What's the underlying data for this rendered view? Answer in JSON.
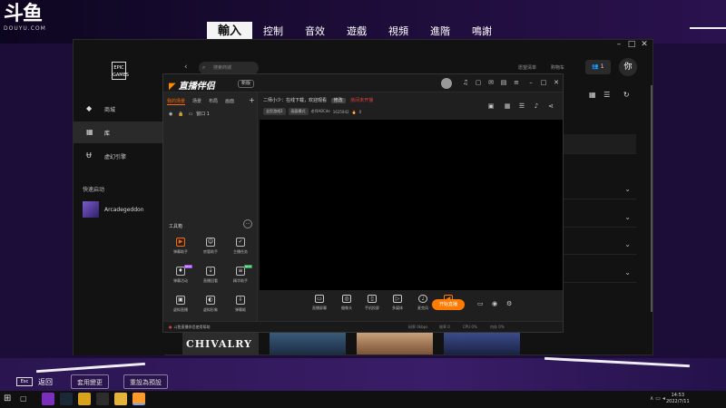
{
  "logo": {
    "mark": "斗鱼",
    "sub": "DOUYU.COM"
  },
  "settings_tabs": [
    {
      "label": "輸入",
      "active": true
    },
    {
      "label": "控制",
      "active": false
    },
    {
      "label": "音效",
      "active": false
    },
    {
      "label": "遊戲",
      "active": false
    },
    {
      "label": "視頻",
      "active": false
    },
    {
      "label": "進階",
      "active": false
    },
    {
      "label": "鳴謝",
      "active": false
    }
  ],
  "epic": {
    "logo_text": "EPIC GAMES",
    "search_placeholder": "搜索商城",
    "nav": [
      {
        "label": "商城",
        "icon": "tag-icon"
      },
      {
        "label": "库",
        "icon": "grid-icon"
      },
      {
        "label": "虚幻引擎",
        "icon": "unreal-icon"
      }
    ],
    "quick_launch_label": "快速启动",
    "quick_launch_game": "Arcadegeddon",
    "header_links": [
      "愿望清单",
      "购物车"
    ],
    "friends_count": "1",
    "avatar_text": "你",
    "game_tiles": [
      "CHIVALRY"
    ]
  },
  "douyu": {
    "brand": "直播伴侣",
    "version": "新版",
    "scene_tabs": [
      "我的场景",
      "场景",
      "布局",
      "画面"
    ],
    "source_row": "窗口 1",
    "toolbox_label": "工具箱",
    "tools": [
      {
        "label": "弹幕助手",
        "hot": true,
        "badge": ""
      },
      {
        "label": "房管助手",
        "hot": false,
        "badge": ""
      },
      {
        "label": "主播任务",
        "hot": false,
        "badge": ""
      },
      {
        "label": "弹幕活动",
        "hot": false,
        "badge": "NEW"
      },
      {
        "label": "直播回看",
        "hot": false,
        "badge": ""
      },
      {
        "label": "精华助手",
        "hot": false,
        "badge": "NEW"
      },
      {
        "label": "虚拟直播",
        "hot": false,
        "badge": ""
      },
      {
        "label": "虚拟形象",
        "hot": false,
        "badge": ""
      },
      {
        "label": "弹幕姬",
        "hot": false,
        "badge": ""
      }
    ],
    "room_title": "二师小少：在线下载，欢迎观看",
    "room_pill": "修改",
    "room_warn": "房间未开播",
    "room_meta": {
      "chip1": "全民游戏2",
      "chip2": "画面模式",
      "handle": "老师ABCde",
      "viewers": "1625942",
      "hot": "0"
    },
    "bottom_buttons": [
      "直播屏幕",
      "摄像头",
      "手机投屏",
      "多媒体",
      "麦克风",
      "扬声器"
    ],
    "start_label": "开始直播",
    "status_left": "斗鱼直播伴侣使用帮助",
    "stats": [
      "码率 0kbps",
      "帧率 0",
      "CPU 0%",
      "内存 0%"
    ]
  },
  "footer": {
    "esc": "Esc",
    "back": "返回",
    "apply": "套用變更",
    "reset": "重設為預設"
  },
  "taskbar": {
    "time": "14:53",
    "date": "2022/7/11"
  },
  "colors": {
    "accent_orange": "#ff7a00",
    "bg_purple": "#1c0c38"
  }
}
